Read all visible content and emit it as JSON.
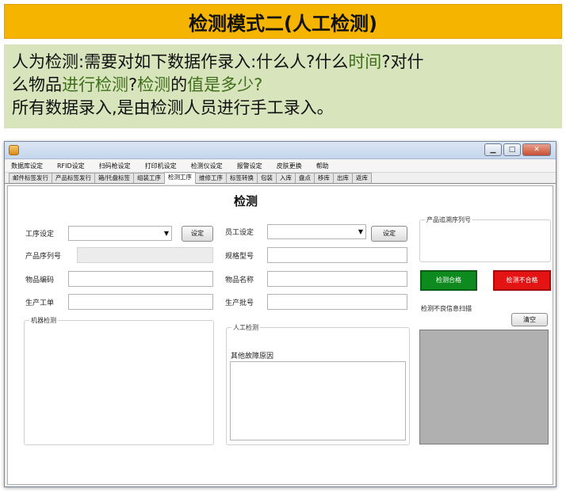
{
  "slide": {
    "title": "检测模式二(人工检测)",
    "desc_line1_a": "人为检测:",
    "desc_line1_b": "需要对",
    "desc_line1_c": "如下数据作录入:什么人?什么",
    "desc_line1_d": "时间",
    "desc_line1_e": "?对什",
    "desc_line2_a": "么物品",
    "desc_line2_b": "进行检测",
    "desc_line2_c": "?",
    "desc_line2_d": "检测",
    "desc_line2_e": "的",
    "desc_line2_f": "值是多少?",
    "desc_line3": "所有数据录入,是由检测人员进行手工录入。"
  },
  "window": {
    "minimize": "▁",
    "maximize": "□",
    "close": "✕"
  },
  "menu": [
    "数据库设定",
    "RFID设定",
    "扫码枪设定",
    "打印机设定",
    "检测仪设定",
    "报警设定",
    "皮肤更换",
    "帮助"
  ],
  "tabs": [
    "邮件标签发行",
    "产品标签发行",
    "箱/托盘标签",
    "组装工序",
    "检测工序",
    "维修工序",
    "标签转换",
    "包装",
    "入库",
    "盘点",
    "移库",
    "出库",
    "返库"
  ],
  "active_tab": "检测工序",
  "form": {
    "title": "检测",
    "process_label": "工序设定",
    "process_set_btn": "设定",
    "employee_label": "员工设定",
    "employee_set_btn": "设定",
    "serial_label": "产品序列号",
    "spec_label": "规格型号",
    "item_code_label": "物品编码",
    "item_name_label": "物品名称",
    "work_order_label": "生产工单",
    "batch_label": "生产批号",
    "machine_group": "机器检测",
    "manual_group": "人工检测",
    "other_fault_label": "其他故障原因",
    "serial_group": "产品追溯序列号",
    "pass_btn": "检测合格",
    "fail_btn": "检测不合格",
    "scan_label": "检测不良信息扫描",
    "clear_btn": "清空"
  }
}
